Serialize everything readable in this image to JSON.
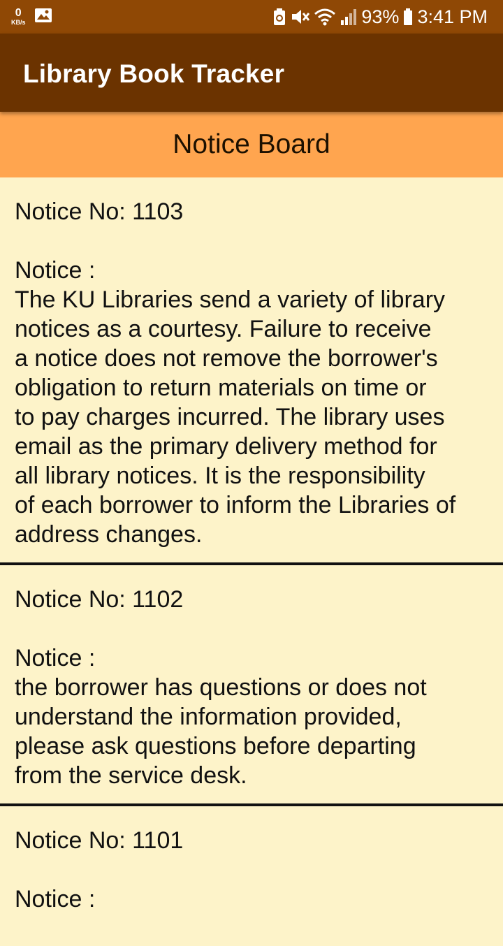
{
  "status_bar": {
    "net_speed_value": "0",
    "net_speed_unit": "KB/s",
    "battery": "93%",
    "time": "3:41 PM"
  },
  "app_bar": {
    "title": "Library Book Tracker"
  },
  "header": {
    "title": "Notice Board"
  },
  "notices": [
    {
      "number_line": "Notice No: 1103",
      "label": "Notice :",
      "text": "The KU Libraries send a variety of library\nnotices as a courtesy.  Failure to receive\na notice does not remove the borrower's\nobligation to return materials on time or\nto pay charges incurred. The library uses\nemail as the primary delivery method for\nall library notices.  It is the responsibility\nof each borrower to inform the Libraries of\naddress changes."
    },
    {
      "number_line": "Notice No: 1102",
      "label": "Notice :",
      "text": "the borrower has questions or does not\nunderstand the information provided,\nplease ask questions before departing\nfrom the service desk."
    },
    {
      "number_line": "Notice No: 1101",
      "label": "Notice :",
      "text": ""
    }
  ]
}
